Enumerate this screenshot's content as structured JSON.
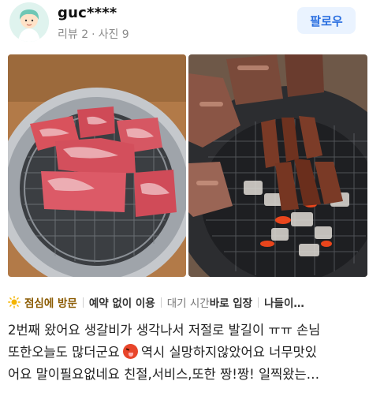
{
  "review": {
    "username": "guc****",
    "review_label": "리뷰 2",
    "photo_label": "사진 9",
    "follow_label": "팔로우"
  },
  "photos": [
    {
      "name": "photo-raw-galbi-on-grill"
    },
    {
      "name": "photo-galbi-grilling-on-charcoal"
    }
  ],
  "tags": [
    {
      "bold": "점심에 방문",
      "highlight": true,
      "icon": "sun-icon"
    },
    {
      "bold": "예약 없이 이용"
    },
    {
      "normal": "대기 시간 ",
      "bold": "바로 입장"
    },
    {
      "bold": "나들이…"
    }
  ],
  "text": {
    "line1": "2번째 왔어요 생갈비가 생각나서 저절로 발길이 ㅠㅠ 손님",
    "line2a": "또한오늘도 많더군요",
    "line2b": "역시 실망하지않았어요 너무맛있",
    "line3": "어요 말이필요없네요 친절,서비스,또한 짱!짱! 일찍왔는…",
    "emoji": "squinting-face-tongue-icon"
  },
  "colors": {
    "follow_bg": "#eaf3ff",
    "follow_text": "#2a6fe0",
    "accent_tag": "#8a5a00"
  }
}
